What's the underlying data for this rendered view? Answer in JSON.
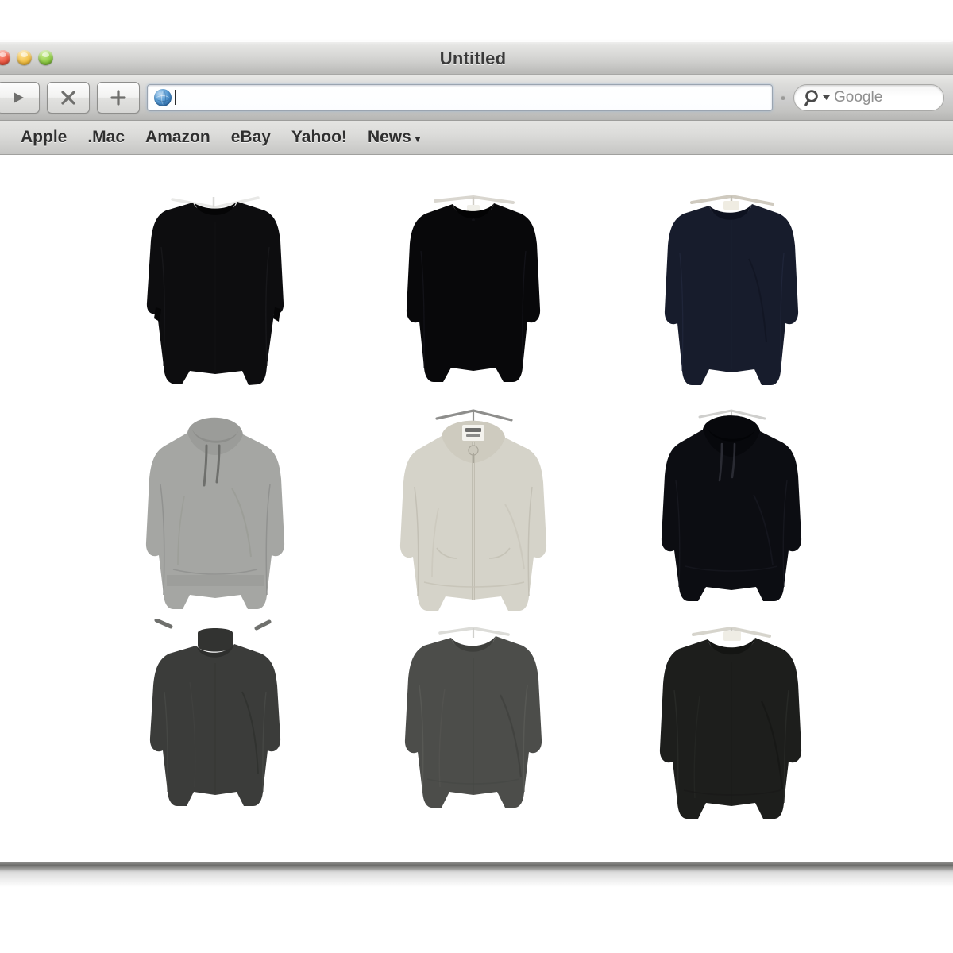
{
  "window": {
    "title": "Untitled",
    "controls": [
      {
        "name": "close",
        "color": "#e8513b"
      },
      {
        "name": "minimize",
        "color": "#f0bb3c"
      },
      {
        "name": "zoom",
        "color": "#86c53c"
      }
    ]
  },
  "toolbar": {
    "buttons": [
      {
        "icon": "play-forward-icon",
        "label": ""
      },
      {
        "icon": "stop-x-icon",
        "label": ""
      },
      {
        "icon": "add-plus-icon",
        "label": ""
      }
    ],
    "address_bar": {
      "icon": "globe-icon",
      "value": "",
      "placeholder": ""
    },
    "search": {
      "icon": "magnifier-q-icon",
      "dropdown_icon": "chevron-down-icon",
      "placeholder": "Google",
      "value": ""
    }
  },
  "bookmarks": {
    "items": [
      {
        "label": "Apple",
        "has_menu": false
      },
      {
        "label": ".Mac",
        "has_menu": false
      },
      {
        "label": "Amazon",
        "has_menu": false
      },
      {
        "label": "eBay",
        "has_menu": false
      },
      {
        "label": "Yahoo!",
        "has_menu": false
      },
      {
        "label": "News",
        "has_menu": true,
        "menu_glyph": "▾"
      }
    ]
  },
  "content": {
    "layout": "grid-3x3",
    "items": [
      {
        "name": "black-crewneck-long-sleeve",
        "type": "crewneck-sweater",
        "color": "#0d0d0f",
        "color_name": "black",
        "hanger": true,
        "hanger_color": "#e8e8e6",
        "row": 1,
        "col": 1
      },
      {
        "name": "black-fine-knit-crewneck",
        "type": "crewneck-sweater",
        "color": "#08080a",
        "color_name": "black",
        "hanger": true,
        "hanger_color": "#d9d6cf",
        "row": 1,
        "col": 2
      },
      {
        "name": "navy-crewneck-long-sleeve",
        "type": "crewneck-sweater",
        "color": "#171c2c",
        "color_name": "navy",
        "hanger": true,
        "hanger_color": "#cfcabf",
        "row": 1,
        "col": 3
      },
      {
        "name": "grey-pullover-hoodie",
        "type": "pullover-hoodie",
        "color": "#a5a6a3",
        "color_name": "heather grey",
        "hanger": false,
        "hanger_color": "#cccccc",
        "row": 2,
        "col": 1
      },
      {
        "name": "oatmeal-zip-hoodie",
        "type": "zip-hoodie",
        "color": "#d5d3c9",
        "color_name": "oatmeal grey",
        "hanger": true,
        "hanger_color": "#8e8e8c",
        "row": 2,
        "col": 2
      },
      {
        "name": "black-pullover-hoodie",
        "type": "pullover-hoodie",
        "color": "#0c0d12",
        "color_name": "black",
        "hanger": true,
        "hanger_color": "#cfcfcd",
        "row": 2,
        "col": 3
      },
      {
        "name": "charcoal-turtleneck",
        "type": "turtleneck",
        "color": "#3b3c3a",
        "color_name": "charcoal",
        "hanger": false,
        "hanger_color": "#555555",
        "row": 3,
        "col": 1
      },
      {
        "name": "grey-crewneck-sweater",
        "type": "crewneck-sweater",
        "color": "#4c4d4a",
        "color_name": "dark grey",
        "hanger": true,
        "hanger_color": "#dcdcd8",
        "row": 3,
        "col": 2
      },
      {
        "name": "charcoal-knit-crewneck",
        "type": "crewneck-sweater",
        "color": "#1d1e1c",
        "color_name": "charcoal black",
        "hanger": true,
        "hanger_color": "#d6d4cc",
        "row": 3,
        "col": 3
      }
    ]
  }
}
